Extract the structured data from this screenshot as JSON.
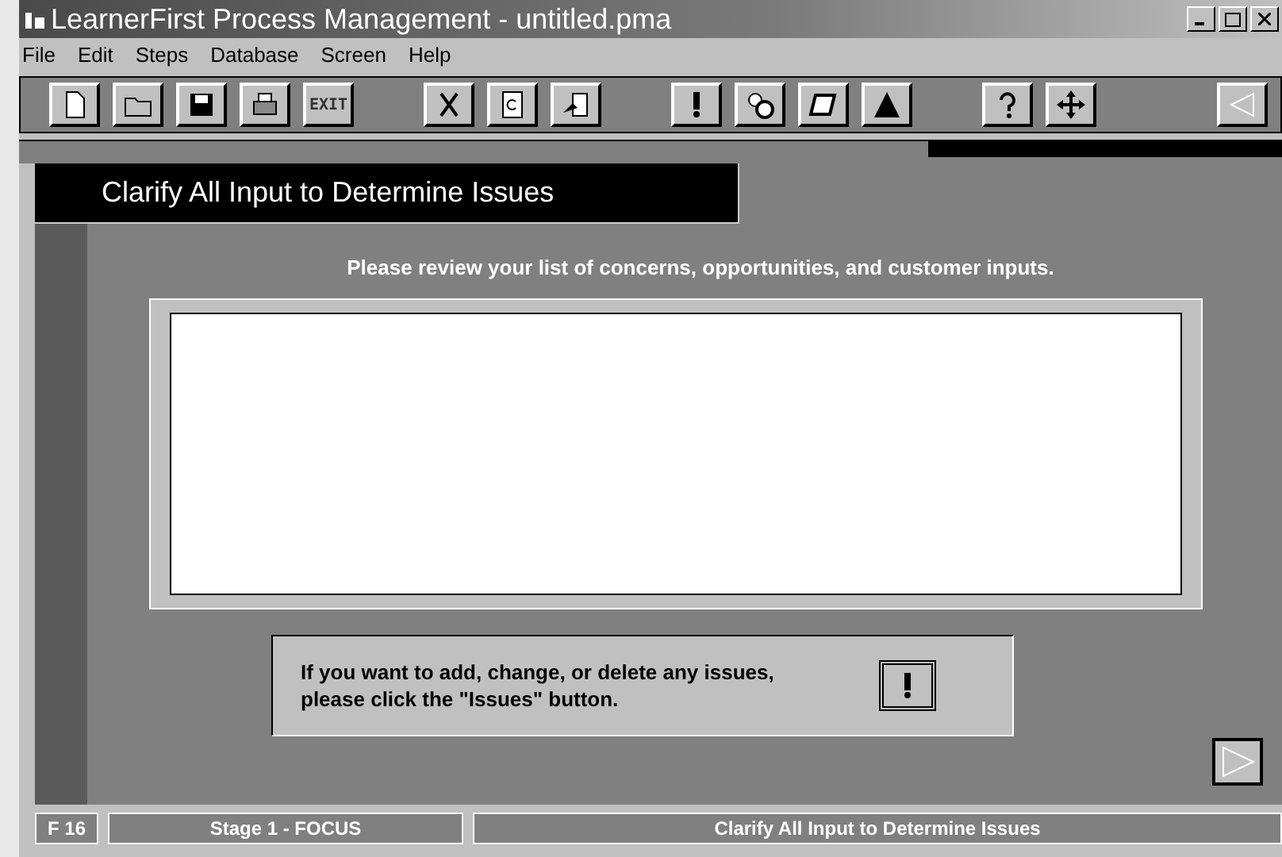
{
  "window": {
    "title": "LearnerFirst Process Management - untitled.pma"
  },
  "menu": [
    "File",
    "Edit",
    "Steps",
    "Database",
    "Screen",
    "Help"
  ],
  "toolbar": [
    {
      "kind": "new"
    },
    {
      "kind": "open"
    },
    {
      "kind": "save"
    },
    {
      "kind": "print"
    },
    {
      "kind": "text",
      "label": "EXIT"
    },
    {
      "kind": "gap"
    },
    {
      "kind": "cut"
    },
    {
      "kind": "copy"
    },
    {
      "kind": "paste"
    },
    {
      "kind": "gap"
    },
    {
      "kind": "issue"
    },
    {
      "kind": "gears"
    },
    {
      "kind": "stack"
    },
    {
      "kind": "triangle"
    },
    {
      "kind": "gap"
    },
    {
      "kind": "help"
    },
    {
      "kind": "move"
    },
    {
      "kind": "gap"
    },
    {
      "kind": "back"
    }
  ],
  "progress": {
    "level": 0.28
  },
  "page": {
    "heading": "Clarify All Input to Determine Issues",
    "instruction": "Please review your list of concerns, opportunities, and customer inputs.",
    "note": "If you want to add, change, or delete any issues, please click the \"Issues\" button."
  },
  "status_bar": [
    "F 16",
    "Stage 1 - FOCUS",
    "Clarify All Input to Determine Issues"
  ]
}
